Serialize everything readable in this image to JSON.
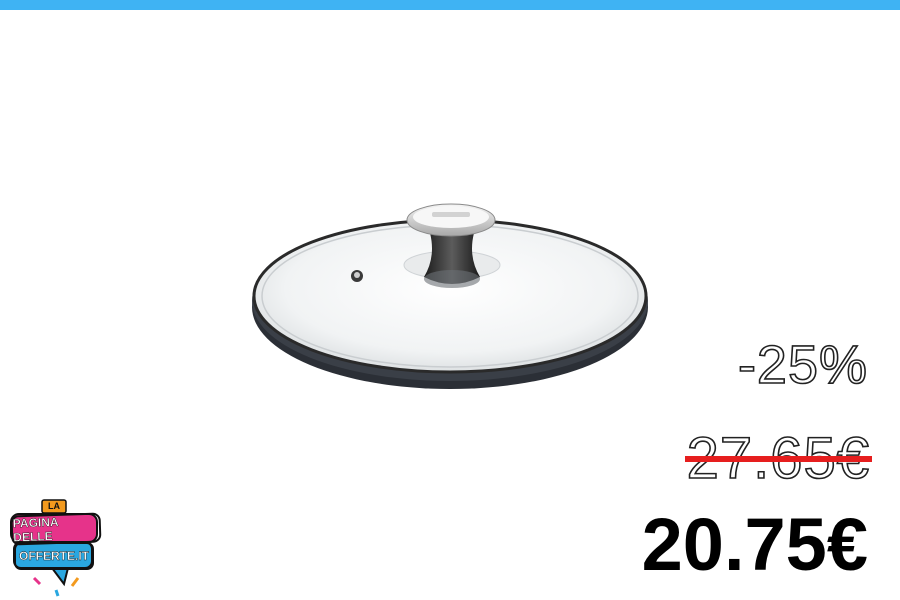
{
  "colors": {
    "top_bar": "#3fb3f3",
    "strike": "#e61e1e",
    "logo_pink": "#e6338a",
    "logo_blue": "#2aa7e0",
    "logo_orange": "#f39a1e"
  },
  "product": {
    "image": "glass-pot-lid"
  },
  "offer": {
    "discount": "-25%",
    "old_price": "27.65€",
    "price": "20.75€"
  },
  "logo": {
    "line1": "LA",
    "line2": "PAGINA DELLE",
    "line3": "OFFERTE.IT"
  }
}
